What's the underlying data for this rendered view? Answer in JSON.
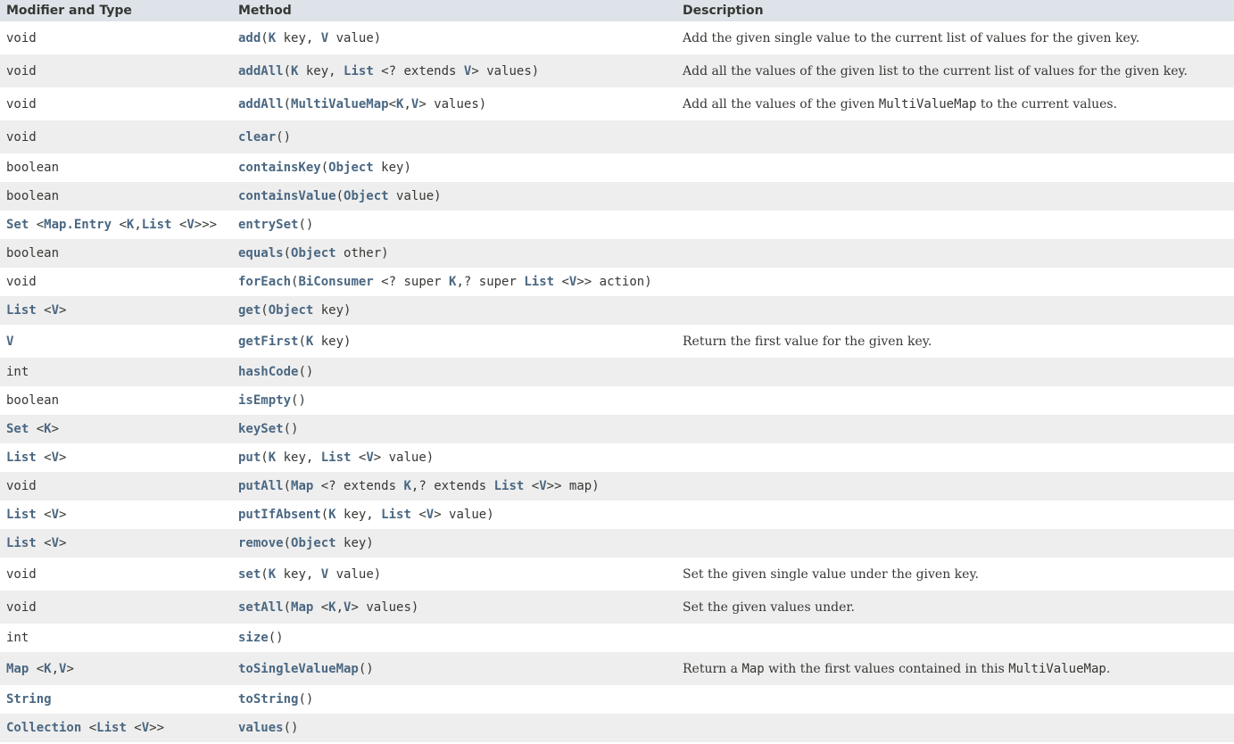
{
  "colors": {
    "header_bg": "#dee3e9",
    "row_alt_bg": "#eeeeee",
    "row_bg": "#ffffff",
    "link": "#4a6782",
    "text": "#353833"
  },
  "headers": {
    "type": "Modifier and Type",
    "method": "Method",
    "description": "Description"
  },
  "rows": [
    {
      "tall": true,
      "type": [
        {
          "t": "void"
        }
      ],
      "method": [
        {
          "t": "add",
          "link": true
        },
        {
          "t": "("
        },
        {
          "t": "K",
          "link": true
        },
        {
          "t": " key, "
        },
        {
          "t": "V",
          "link": true
        },
        {
          "t": " value)"
        }
      ],
      "desc": [
        {
          "t": "Add the given single value to the current list of values for the given key."
        }
      ]
    },
    {
      "tall": true,
      "type": [
        {
          "t": "void"
        }
      ],
      "method": [
        {
          "t": "addAll",
          "link": true
        },
        {
          "t": "("
        },
        {
          "t": "K",
          "link": true
        },
        {
          "t": " key, "
        },
        {
          "t": "List",
          "link": true
        },
        {
          "t": " <? extends "
        },
        {
          "t": "V",
          "link": true
        },
        {
          "t": "> values)"
        }
      ],
      "desc": [
        {
          "t": "Add all the values of the given list to the current list of values for the given key."
        }
      ]
    },
    {
      "tall": true,
      "type": [
        {
          "t": "void"
        }
      ],
      "method": [
        {
          "t": "addAll",
          "link": true
        },
        {
          "t": "("
        },
        {
          "t": "MultiValueMap",
          "link": true
        },
        {
          "t": "<"
        },
        {
          "t": "K",
          "link": true
        },
        {
          "t": ","
        },
        {
          "t": "V",
          "link": true
        },
        {
          "t": "> values)"
        }
      ],
      "desc": [
        {
          "t": "Add all the values of the given "
        },
        {
          "t": "MultiValueMap",
          "code": true
        },
        {
          "t": " to the current values."
        }
      ]
    },
    {
      "tall": true,
      "type": [
        {
          "t": "void"
        }
      ],
      "method": [
        {
          "t": "clear",
          "link": true
        },
        {
          "t": "()"
        }
      ],
      "desc": []
    },
    {
      "type": [
        {
          "t": "boolean"
        }
      ],
      "method": [
        {
          "t": "containsKey",
          "link": true
        },
        {
          "t": "("
        },
        {
          "t": "Object",
          "link": true
        },
        {
          "t": "  key)"
        }
      ],
      "desc": []
    },
    {
      "type": [
        {
          "t": "boolean"
        }
      ],
      "method": [
        {
          "t": "containsValue",
          "link": true
        },
        {
          "t": "("
        },
        {
          "t": "Object",
          "link": true
        },
        {
          "t": "  value)"
        }
      ],
      "desc": []
    },
    {
      "type": [
        {
          "t": "Set",
          "link": true
        },
        {
          "t": " <"
        },
        {
          "t": "Map.Entry",
          "link": true
        },
        {
          "t": " <"
        },
        {
          "t": "K",
          "link": true
        },
        {
          "t": ","
        },
        {
          "t": "List",
          "link": true
        },
        {
          "t": " <"
        },
        {
          "t": "V",
          "link": true
        },
        {
          "t": ">>>"
        }
      ],
      "method": [
        {
          "t": "entrySet",
          "link": true
        },
        {
          "t": "()"
        }
      ],
      "desc": []
    },
    {
      "type": [
        {
          "t": "boolean"
        }
      ],
      "method": [
        {
          "t": "equals",
          "link": true
        },
        {
          "t": "("
        },
        {
          "t": "Object",
          "link": true
        },
        {
          "t": "  other)"
        }
      ],
      "desc": []
    },
    {
      "type": [
        {
          "t": "void"
        }
      ],
      "method": [
        {
          "t": "forEach",
          "link": true
        },
        {
          "t": "("
        },
        {
          "t": "BiConsumer",
          "link": true
        },
        {
          "t": " <? super "
        },
        {
          "t": "K",
          "link": true
        },
        {
          "t": ",? super "
        },
        {
          "t": "List",
          "link": true
        },
        {
          "t": " <"
        },
        {
          "t": "V",
          "link": true
        },
        {
          "t": ">> action)"
        }
      ],
      "desc": []
    },
    {
      "type": [
        {
          "t": "List",
          "link": true
        },
        {
          "t": " <"
        },
        {
          "t": "V",
          "link": true
        },
        {
          "t": ">"
        }
      ],
      "method": [
        {
          "t": "get",
          "link": true
        },
        {
          "t": "("
        },
        {
          "t": "Object",
          "link": true
        },
        {
          "t": "  key)"
        }
      ],
      "desc": []
    },
    {
      "tall": true,
      "type": [
        {
          "t": "V",
          "link": true
        }
      ],
      "method": [
        {
          "t": "getFirst",
          "link": true
        },
        {
          "t": "("
        },
        {
          "t": "K",
          "link": true
        },
        {
          "t": " key)"
        }
      ],
      "desc": [
        {
          "t": "Return the first value for the given key."
        }
      ]
    },
    {
      "type": [
        {
          "t": "int"
        }
      ],
      "method": [
        {
          "t": "hashCode",
          "link": true
        },
        {
          "t": "()"
        }
      ],
      "desc": []
    },
    {
      "type": [
        {
          "t": "boolean"
        }
      ],
      "method": [
        {
          "t": "isEmpty",
          "link": true
        },
        {
          "t": "()"
        }
      ],
      "desc": []
    },
    {
      "type": [
        {
          "t": "Set",
          "link": true
        },
        {
          "t": " <"
        },
        {
          "t": "K",
          "link": true
        },
        {
          "t": ">"
        }
      ],
      "method": [
        {
          "t": "keySet",
          "link": true
        },
        {
          "t": "()"
        }
      ],
      "desc": []
    },
    {
      "type": [
        {
          "t": "List",
          "link": true
        },
        {
          "t": " <"
        },
        {
          "t": "V",
          "link": true
        },
        {
          "t": ">"
        }
      ],
      "method": [
        {
          "t": "put",
          "link": true
        },
        {
          "t": "("
        },
        {
          "t": "K",
          "link": true
        },
        {
          "t": " key, "
        },
        {
          "t": "List",
          "link": true
        },
        {
          "t": " <"
        },
        {
          "t": "V",
          "link": true
        },
        {
          "t": "> value)"
        }
      ],
      "desc": []
    },
    {
      "type": [
        {
          "t": "void"
        }
      ],
      "method": [
        {
          "t": "putAll",
          "link": true
        },
        {
          "t": "("
        },
        {
          "t": "Map",
          "link": true
        },
        {
          "t": " <? extends "
        },
        {
          "t": "K",
          "link": true
        },
        {
          "t": ",? extends "
        },
        {
          "t": "List",
          "link": true
        },
        {
          "t": " <"
        },
        {
          "t": "V",
          "link": true
        },
        {
          "t": ">> map)"
        }
      ],
      "desc": []
    },
    {
      "type": [
        {
          "t": "List",
          "link": true
        },
        {
          "t": " <"
        },
        {
          "t": "V",
          "link": true
        },
        {
          "t": ">"
        }
      ],
      "method": [
        {
          "t": "putIfAbsent",
          "link": true
        },
        {
          "t": "("
        },
        {
          "t": "K",
          "link": true
        },
        {
          "t": " key, "
        },
        {
          "t": "List",
          "link": true
        },
        {
          "t": " <"
        },
        {
          "t": "V",
          "link": true
        },
        {
          "t": "> value)"
        }
      ],
      "desc": []
    },
    {
      "type": [
        {
          "t": "List",
          "link": true
        },
        {
          "t": " <"
        },
        {
          "t": "V",
          "link": true
        },
        {
          "t": ">"
        }
      ],
      "method": [
        {
          "t": "remove",
          "link": true
        },
        {
          "t": "("
        },
        {
          "t": "Object",
          "link": true
        },
        {
          "t": "  key)"
        }
      ],
      "desc": []
    },
    {
      "tall": true,
      "type": [
        {
          "t": "void"
        }
      ],
      "method": [
        {
          "t": "set",
          "link": true
        },
        {
          "t": "("
        },
        {
          "t": "K",
          "link": true
        },
        {
          "t": " key, "
        },
        {
          "t": "V",
          "link": true
        },
        {
          "t": " value)"
        }
      ],
      "desc": [
        {
          "t": "Set the given single value under the given key."
        }
      ]
    },
    {
      "tall": true,
      "type": [
        {
          "t": "void"
        }
      ],
      "method": [
        {
          "t": "setAll",
          "link": true
        },
        {
          "t": "("
        },
        {
          "t": "Map",
          "link": true
        },
        {
          "t": " <"
        },
        {
          "t": "K",
          "link": true
        },
        {
          "t": ","
        },
        {
          "t": "V",
          "link": true
        },
        {
          "t": "> values)"
        }
      ],
      "desc": [
        {
          "t": "Set the given values under."
        }
      ]
    },
    {
      "type": [
        {
          "t": "int"
        }
      ],
      "method": [
        {
          "t": "size",
          "link": true
        },
        {
          "t": "()"
        }
      ],
      "desc": []
    },
    {
      "tall": true,
      "type": [
        {
          "t": "Map",
          "link": true
        },
        {
          "t": " <"
        },
        {
          "t": "K",
          "link": true
        },
        {
          "t": ","
        },
        {
          "t": "V",
          "link": true
        },
        {
          "t": ">"
        }
      ],
      "method": [
        {
          "t": "toSingleValueMap",
          "link": true
        },
        {
          "t": "()"
        }
      ],
      "desc": [
        {
          "t": "Return a "
        },
        {
          "t": "Map",
          "code": true
        },
        {
          "t": " with the first values contained in this "
        },
        {
          "t": "MultiValueMap",
          "code": true
        },
        {
          "t": "."
        }
      ]
    },
    {
      "type": [
        {
          "t": "String",
          "link": true
        }
      ],
      "method": [
        {
          "t": "toString",
          "link": true
        },
        {
          "t": "()"
        }
      ],
      "desc": []
    },
    {
      "type": [
        {
          "t": "Collection",
          "link": true
        },
        {
          "t": " <"
        },
        {
          "t": "List",
          "link": true
        },
        {
          "t": " <"
        },
        {
          "t": "V",
          "link": true
        },
        {
          "t": ">>"
        }
      ],
      "method": [
        {
          "t": "values",
          "link": true
        },
        {
          "t": "()"
        }
      ],
      "desc": []
    }
  ]
}
